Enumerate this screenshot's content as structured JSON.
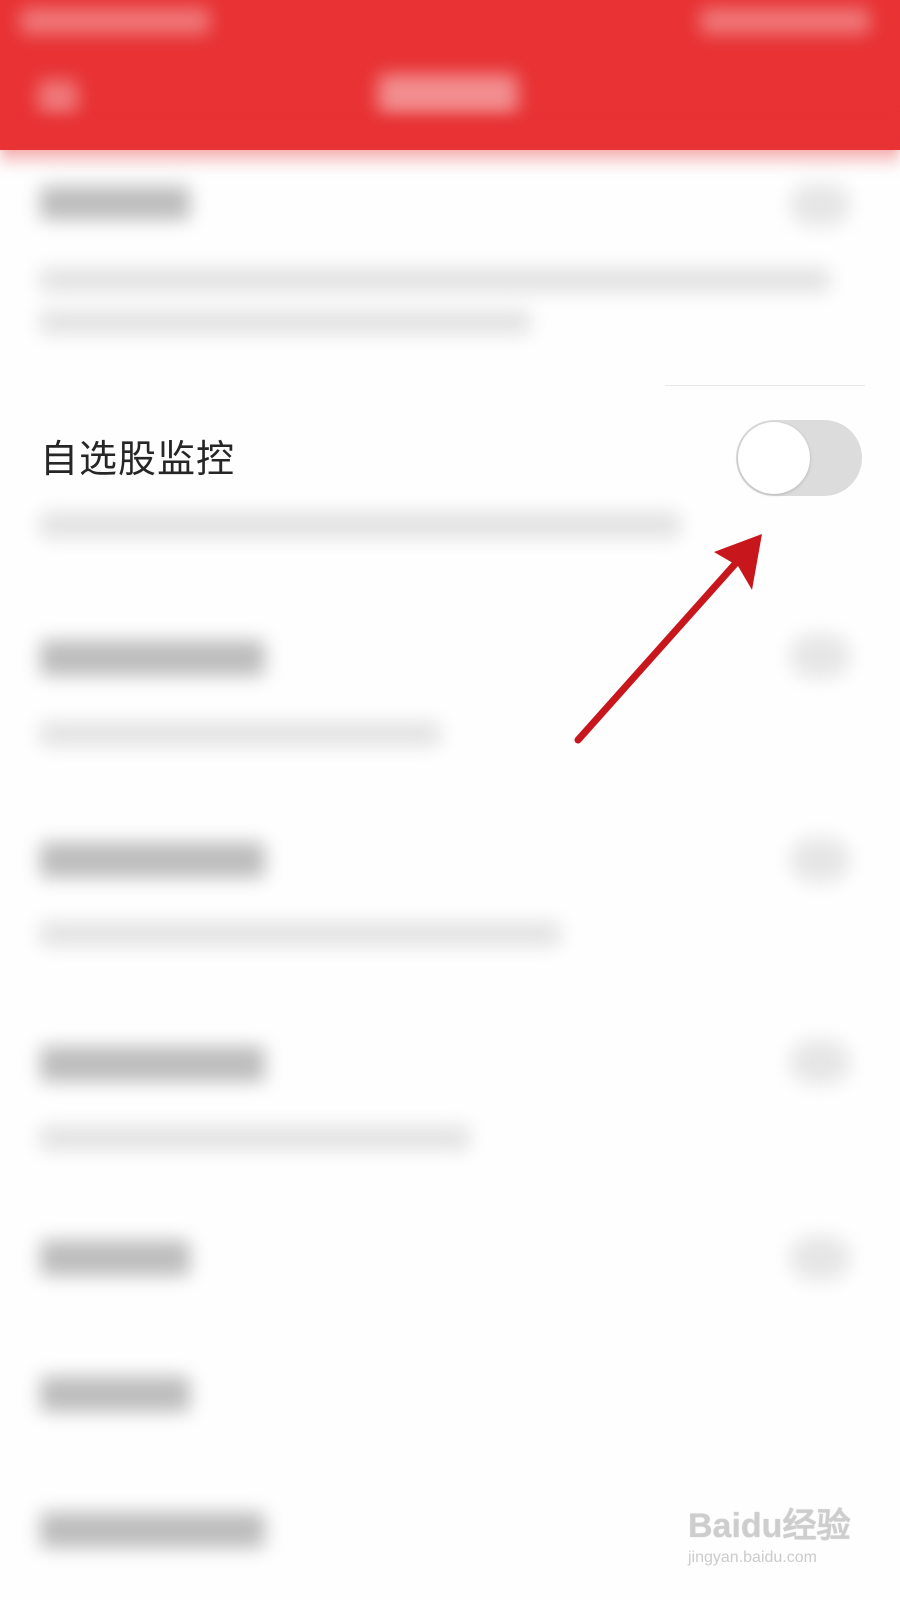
{
  "setting": {
    "label": "自选股监控",
    "toggle_on": false
  },
  "colors": {
    "header": "#e83234",
    "toggle_off_track": "#dcdcdc",
    "toggle_knob": "#ffffff",
    "arrow": "#c8161d"
  },
  "watermark": {
    "brand": "Baidu经验",
    "url": "jingyan.baidu.com"
  }
}
